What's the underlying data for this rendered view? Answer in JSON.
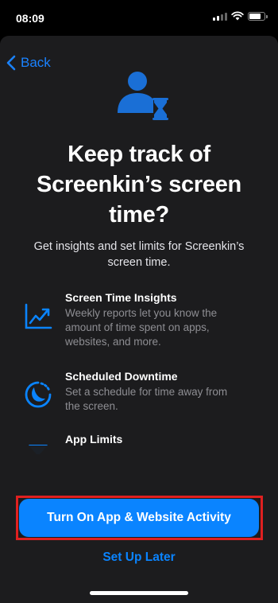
{
  "status_bar": {
    "time": "08:09"
  },
  "nav": {
    "back_label": "Back"
  },
  "content": {
    "title": "Keep track of Screenkin’s screen time?",
    "subtitle": "Get insights and set limits for Screenkin’s screen time."
  },
  "features": [
    {
      "title": "Screen Time Insights",
      "description": "Weekly reports let you know the amount of time spent on apps, websites, and more.",
      "icon": "chart-icon"
    },
    {
      "title": "Scheduled Downtime",
      "description": "Set a schedule for time away from the screen.",
      "icon": "downtime-icon"
    },
    {
      "title": "App Limits",
      "description": "",
      "icon": "hourglass-icon"
    }
  ],
  "actions": {
    "primary_label": "Turn On App & Website Activity",
    "secondary_label": "Set Up Later"
  },
  "colors": {
    "accent": "#0a84ff",
    "highlight": "#e02020",
    "sheet_background": "#1c1c1e"
  }
}
